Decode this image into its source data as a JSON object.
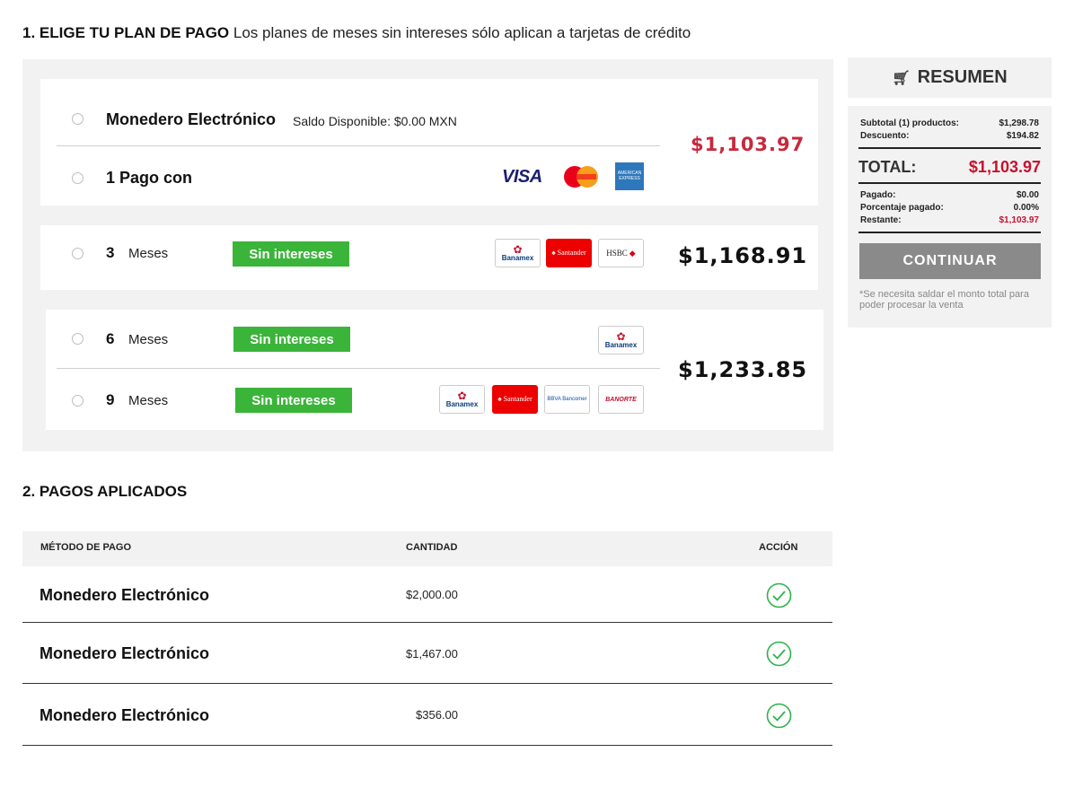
{
  "section1": {
    "number_title": "1. ELIGE TU PLAN DE PAGO",
    "subtitle": "Los planes de meses sin intereses sólo aplican a tarjetas de crédito"
  },
  "plans": {
    "wallet_label": "Monedero Electrónico",
    "wallet_balance": "Saldo Disponible: $0.00 MXN",
    "one_payment_label": "1 Pago con",
    "one_payment_price": "$1,103.97",
    "card_brands": [
      "VISA",
      "MasterCard",
      "AMERICAN EXPRESS"
    ],
    "plan3": {
      "number": "3",
      "unit": "Meses",
      "badge": "Sin intereses",
      "price": "$1,168.91",
      "banks": [
        "Banamex",
        "Santander",
        "HSBC"
      ]
    },
    "plan6": {
      "number": "6",
      "unit": "Meses",
      "badge": "Sin intereses",
      "banks": [
        "Banamex"
      ]
    },
    "plan9": {
      "number": "9",
      "unit": "Meses",
      "badge": "Sin intereses",
      "banks": [
        "Banamex",
        "Santander",
        "BBVA Bancomer",
        "BANORTE"
      ]
    },
    "plan69_price": "$1,233.85"
  },
  "summary": {
    "title": "RESUMEN",
    "subtotal_label": "Subtotal (1) productos:",
    "subtotal_value": "$1,298.78",
    "discount_label": "Descuento:",
    "discount_value": "$194.82",
    "total_label": "TOTAL:",
    "total_value": "$1,103.97",
    "paid_label": "Pagado:",
    "paid_value": "$0.00",
    "percent_label": "Porcentaje pagado:",
    "percent_value": "0.00%",
    "remaining_label": "Restante:",
    "remaining_value": "$1,103.97",
    "continue_button": "CONTINUAR",
    "note": "*Se necesita saldar el monto total para poder procesar la venta"
  },
  "section2": {
    "title": "2. PAGOS APLICADOS"
  },
  "payments_table": {
    "headers": [
      "MÉTODO DE PAGO",
      "CANTIDAD",
      "ACCIÓN"
    ],
    "rows": [
      {
        "method": "Monedero Electrónico",
        "amount": "$2,000.00"
      },
      {
        "method": "Monedero Electrónico",
        "amount": "$1,467.00"
      },
      {
        "method": "Monedero Electrónico",
        "amount": "$356.00"
      }
    ]
  },
  "colors": {
    "accent_red": "#c8283c",
    "badge_green": "#3bb43a",
    "check_green": "#2db34a",
    "panel_gray": "#f2f2f2",
    "button_gray": "#8a8a8a"
  },
  "icons": {
    "cart": "cart-icon",
    "check": "check-circle-icon",
    "radio": "radio-icon"
  }
}
